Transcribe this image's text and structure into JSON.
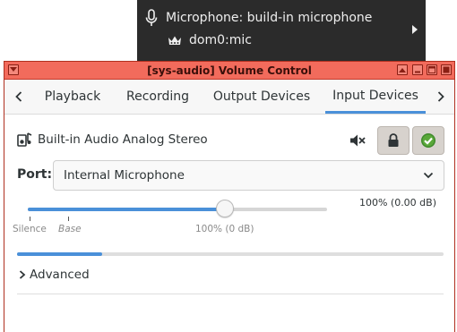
{
  "popup": {
    "device_label": "Microphone: build-in microphone",
    "vm_label": "dom0:mic",
    "icons": {
      "mic": "microphone-icon",
      "crown": "crown-icon",
      "arrow": "chevron-right-icon"
    }
  },
  "window": {
    "title": "[sys-audio] Volume Control",
    "titlebar_color": "#f26b5c"
  },
  "tabs": {
    "items": [
      "Playback",
      "Recording",
      "Output Devices",
      "Input Devices"
    ],
    "active": "Input Devices",
    "accent": "#4a90d9"
  },
  "device": {
    "name": "Built-in Audio Analog Stereo",
    "muted": false,
    "locked": true,
    "default": true
  },
  "port": {
    "label": "Port:",
    "selected": "Internal Microphone"
  },
  "volume": {
    "readout": "100% (0.00 dB)",
    "percent": 100,
    "marks": {
      "silence": "Silence",
      "base": "Base",
      "hundred": "100% (0 dB)"
    }
  },
  "meter": {
    "level": 0.2
  },
  "advanced": {
    "label": "Advanced"
  }
}
